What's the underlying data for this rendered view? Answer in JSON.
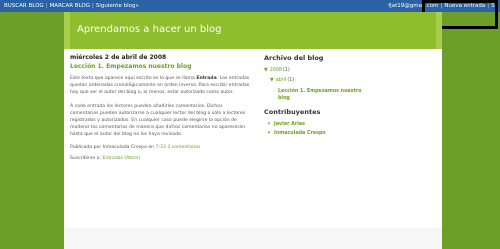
{
  "navbar": {
    "search_label": "BUSCAR BLOG",
    "mark_label": "MARCAR BLOG",
    "next_label": "Siguiente blog»",
    "user_email": "fjat19@gmail.com",
    "new_entry_label": "Nueva entrada",
    "logout_label": "Sa"
  },
  "header": {
    "blog_title": "Aprendamos a hacer un blog"
  },
  "post": {
    "date": "miércoles 2 de abril de 2008",
    "title": "Lección 1. Empezamos nuestro blog",
    "para1_before": "Este texto que aparece aquí escrito es lo que se llama ",
    "para1_em": "Entrada",
    "para1_after": ". Las entradas quedan ordenadas cronológicamente en orden inverso. Para escribir entradas hay que ser el autor del blog o, al menos, estar autorizado como autor.",
    "para2": "A cada entrada los lectores pueden añadirles comentarios. Dichos comentarios pueden autorizarse a cualquier lector del blog o sólo a lectores registrados y autorizados. En cualquier caso puede elegirse la opción de moderar los comentarios de manera que dichos comentarios no aparecerán hasta que el autor del blog no los haya revisado.",
    "footer_published": "Publicado por Inmaculada Crespo en ",
    "footer_time": "7:33",
    "footer_comments": "3 comentarios",
    "subscribe_label": "Suscribirse a: ",
    "subscribe_link": "Entradas (Atom)"
  },
  "sidebar": {
    "archive_heading": "Archivo del blog",
    "archive_year": "2008",
    "archive_year_count": "(1)",
    "archive_month": "abril",
    "archive_month_count": "(1)",
    "archive_post": "Lección 1. Empezamos nuestro blog",
    "contributors_heading": "Contribuyentes",
    "contributors": [
      "Javier Arias",
      "Inmaculada Crespo"
    ]
  },
  "icons": {
    "expand": "triangle-down",
    "bullet": "star"
  },
  "colors": {
    "background": "#6e9e2a",
    "header": "#8ebd2d",
    "navbar": "#2a62a4",
    "link": "#6aa121"
  }
}
